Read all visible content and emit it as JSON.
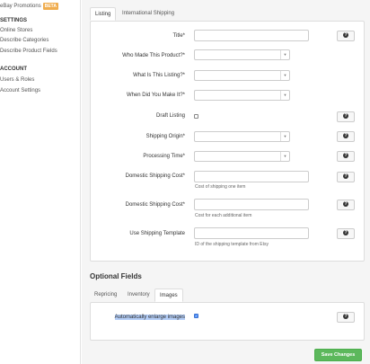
{
  "sidebar": {
    "promo_label": "eBay Promotions",
    "beta_badge": "BETA",
    "settings_heading": "SETTINGS",
    "settings_items": [
      "Online Stores",
      "Describe Categories",
      "Describe Product Fields"
    ],
    "account_heading": "ACCOUNT",
    "account_items": [
      "Users & Roles",
      "Account Settings"
    ]
  },
  "tabs": {
    "listing": "Listing",
    "international_shipping": "International Shipping"
  },
  "form": {
    "title_label": "Title*",
    "who_made_label": "Who Made This Product?*",
    "what_is_label": "What Is This Listing?*",
    "when_made_label": "When Did You Make It?*",
    "draft_label": "Draft Listing",
    "shipping_origin_label": "Shipping Origin*",
    "processing_time_label": "Processing Time*",
    "dom_cost_label": "Domestic Shipping Cost*",
    "dom_cost_hint": "Cost of shipping one item",
    "dom_cost2_label": "Domestic Shipping Cost*",
    "dom_cost2_hint": "Cost for each additional item",
    "template_label": "Use Shipping Template",
    "template_hint": "ID of the shipping template from Etsy",
    "help_glyph": "?"
  },
  "optional": {
    "title": "Optional Fields",
    "tabs": [
      "Repricing",
      "Inventory",
      "Images"
    ],
    "enlarge_label": "Automatically enlarge images"
  },
  "save_label": "Save Changes",
  "colors": {
    "save": "#5cb85c",
    "beta": "#f0ad4e",
    "checkbox_on": "#4a8cf7"
  }
}
